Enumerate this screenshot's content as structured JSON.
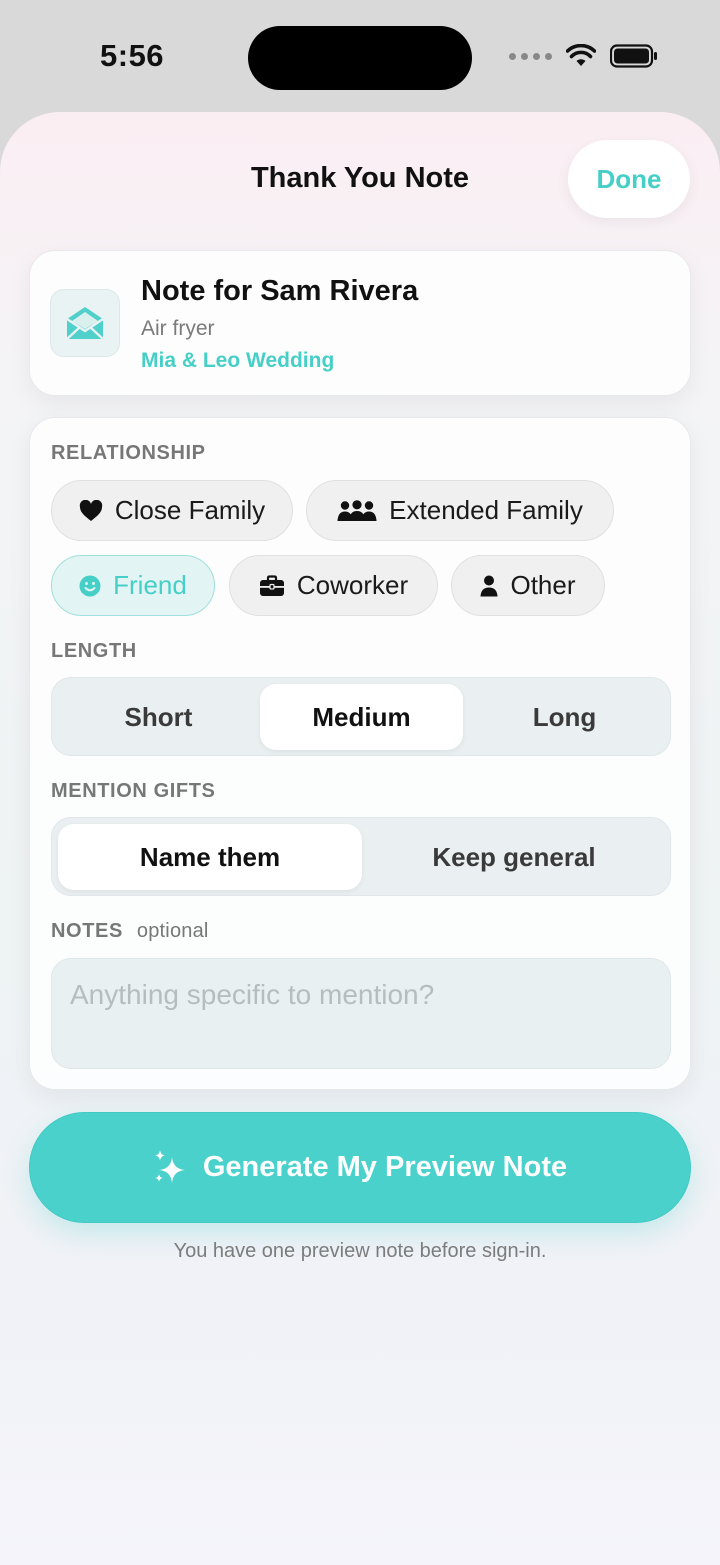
{
  "status_bar": {
    "time": "5:56"
  },
  "header": {
    "title": "Thank You Note",
    "done_label": "Done"
  },
  "note": {
    "title": "Note for Sam Rivera",
    "gift": "Air fryer",
    "event": "Mia & Leo Wedding"
  },
  "relationship": {
    "label": "RELATIONSHIP",
    "options": [
      {
        "label": "Close Family",
        "icon": "heart-icon",
        "selected": false
      },
      {
        "label": "Extended Family",
        "icon": "group-icon",
        "selected": false
      },
      {
        "label": "Friend",
        "icon": "smiley-icon",
        "selected": true
      },
      {
        "label": "Coworker",
        "icon": "briefcase-icon",
        "selected": false
      },
      {
        "label": "Other",
        "icon": "person-icon",
        "selected": false
      }
    ]
  },
  "length": {
    "label": "LENGTH",
    "options": [
      "Short",
      "Medium",
      "Long"
    ],
    "selected": "Medium"
  },
  "mention_gifts": {
    "label": "MENTION GIFTS",
    "options": [
      "Name them",
      "Keep general"
    ],
    "selected": "Name them"
  },
  "notes": {
    "label": "NOTES",
    "optional": "optional",
    "placeholder": "Anything specific to mention?",
    "value": ""
  },
  "generate": {
    "label": "Generate My Preview Note",
    "footnote": "You have one preview note before sign-in."
  },
  "colors": {
    "accent": "#46cfc7",
    "button": "#4ad1cb"
  }
}
